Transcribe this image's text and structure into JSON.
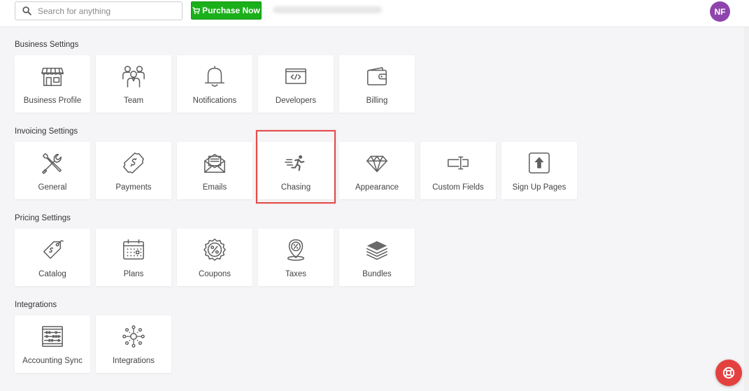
{
  "header": {
    "search_placeholder": "Search for anything",
    "purchase_label": "Purchase Now",
    "avatar_initials": "NF",
    "purchase_color": "#1bb01b",
    "avatar_color": "#8e44ad"
  },
  "sections": [
    {
      "title": "Business Settings",
      "tiles": [
        {
          "label": "Business Profile",
          "icon": "storefront-icon"
        },
        {
          "label": "Team",
          "icon": "team-icon"
        },
        {
          "label": "Notifications",
          "icon": "bell-icon"
        },
        {
          "label": "Developers",
          "icon": "code-window-icon"
        },
        {
          "label": "Billing",
          "icon": "wallet-icon"
        }
      ]
    },
    {
      "title": "Invoicing Settings",
      "tiles": [
        {
          "label": "General",
          "icon": "tools-icon"
        },
        {
          "label": "Payments",
          "icon": "money-icon"
        },
        {
          "label": "Emails",
          "icon": "envelope-icon"
        },
        {
          "label": "Chasing",
          "icon": "running-person-icon"
        },
        {
          "label": "Appearance",
          "icon": "diamond-icon"
        },
        {
          "label": "Custom Fields",
          "icon": "text-field-icon"
        },
        {
          "label": "Sign Up Pages",
          "icon": "upload-arrow-icon"
        }
      ]
    },
    {
      "title": "Pricing Settings",
      "tiles": [
        {
          "label": "Catalog",
          "icon": "price-tag-icon"
        },
        {
          "label": "Plans",
          "icon": "calendar-icon"
        },
        {
          "label": "Coupons",
          "icon": "discount-badge-icon"
        },
        {
          "label": "Taxes",
          "icon": "percent-pin-icon"
        },
        {
          "label": "Bundles",
          "icon": "layers-icon"
        }
      ]
    },
    {
      "title": "Integrations",
      "tiles": [
        {
          "label": "Accounting Sync",
          "icon": "abacus-icon"
        },
        {
          "label": "Integrations",
          "icon": "network-icon"
        }
      ]
    }
  ],
  "highlight_color": "#e34b4b",
  "help_button_color": "#e3413f"
}
